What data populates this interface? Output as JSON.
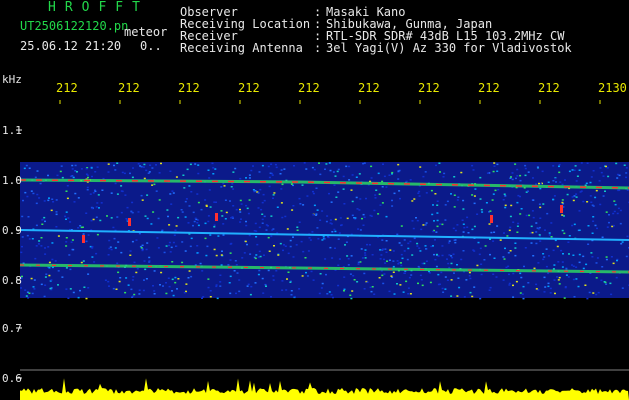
{
  "header": {
    "app_title": "HROFFT",
    "filename": "UT2506122120.pn",
    "mode": "meteor",
    "datetime": "25.06.12 21:20",
    "counter": "0..",
    "fields": [
      {
        "label": "Observer",
        "value": "Masaki Kano"
      },
      {
        "label": "Receiving Location",
        "value": "Shibukawa, Gunma, Japan"
      },
      {
        "label": "Receiver",
        "value": "RTL-SDR SDR# 43dB L15 103.2MHz CW"
      },
      {
        "label": "Receiving Antenna",
        "value": "3el Yagi(V) Az 330 for Vladivostok"
      }
    ],
    "separator": ":"
  },
  "axis": {
    "unit": "kHz",
    "time_ticks": [
      "212",
      "212",
      "212",
      "212",
      "212",
      "212",
      "212",
      "212",
      "212",
      "2130"
    ],
    "freq_ticks": [
      "1.1",
      "1.0",
      "0.9",
      "0.8",
      "0.7",
      "0.6"
    ]
  },
  "colors": {
    "background": "#000000",
    "noise_floor": "#0a1fb0",
    "trace": "#ff3030",
    "amplitude": "#ffff00"
  }
}
